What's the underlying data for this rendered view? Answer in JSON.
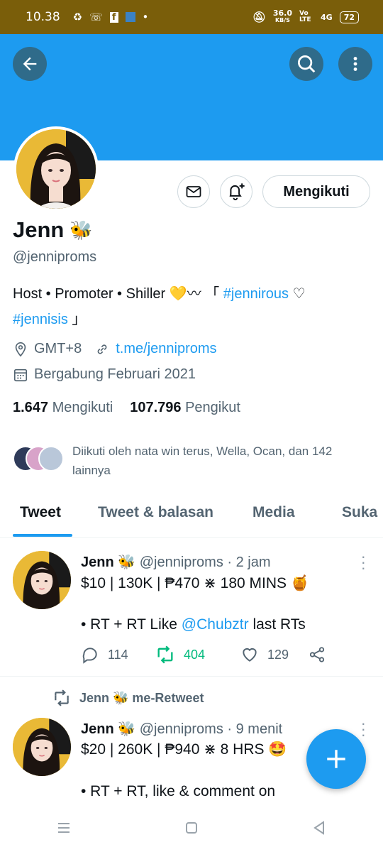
{
  "status_bar": {
    "time": "10.38",
    "network_speed": "36.0",
    "network_unit": "KB/S",
    "volte": "Vo LTE",
    "signal": "4G",
    "battery": "72"
  },
  "profile": {
    "name": "Jenn",
    "name_emoji": "🐝",
    "handle": "@jenniproms",
    "follow_button_label": "Mengikuti",
    "bio_prefix": "Host • Promoter • Shiller 💛〰 「",
    "bio_tag_1": "#jennirous",
    "bio_mid": "♡",
    "bio_tag_2": "#jennisis",
    "bio_suffix": "」",
    "location": "GMT+8",
    "website": "t.me/jenniproms",
    "joined": "Bergabung Februari 2021",
    "following_count": "1.647",
    "following_label": "Mengikuti",
    "followers_count": "107.796",
    "followers_label": "Pengikut",
    "followed_by_text": "Diikuti oleh nata win terus, Wella, Ocan, dan 142 lainnya"
  },
  "tabs": [
    {
      "label": "Tweet",
      "active": true
    },
    {
      "label": "Tweet & balasan",
      "active": false
    },
    {
      "label": "Media",
      "active": false
    },
    {
      "label": "Suka",
      "active": false
    }
  ],
  "tweets": [
    {
      "name": "Jenn",
      "emoji": "🐝",
      "handle": "@jenniproms",
      "time": "· 2 jam",
      "line1": "$10 | 130K | ₱470 ⋇ 180 MINS 🍯",
      "line2_prefix": "• RT + RT Like ",
      "line2_mention": "@Chubztr",
      "line2_suffix": " last RTs",
      "replies": "114",
      "retweets": "404",
      "likes": "129"
    },
    {
      "retweeted_by": "Jenn 🐝 me-Retweet",
      "name": "Jenn",
      "emoji": "🐝",
      "handle": "@jenniproms",
      "time": "· 9 menit",
      "line1": "$20 | 260K | ₱940 ⋇ 8 HRS 🤩",
      "line2": "• RT + RT, like & comment on"
    }
  ],
  "colors": {
    "accent": "#1d9bf0",
    "status_bar": "#7a5e0a",
    "retweet_active": "#00ba7c",
    "secondary_text": "#536471"
  }
}
